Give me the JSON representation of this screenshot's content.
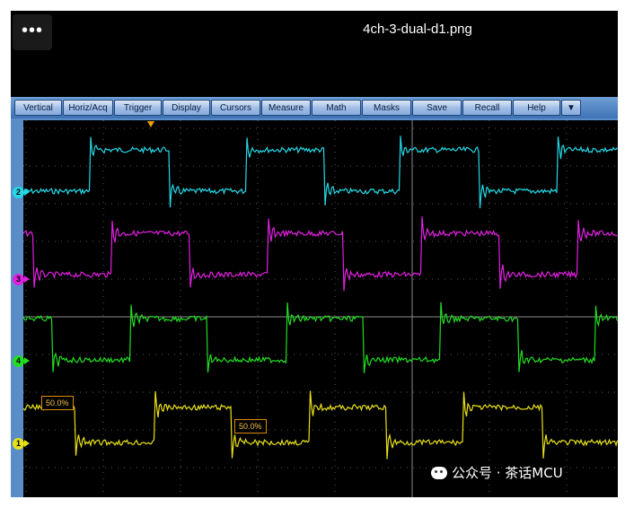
{
  "viewer": {
    "more_label": "•••",
    "file_title": "4ch-3-dual-d1.png"
  },
  "menu": {
    "items": [
      "Vertical",
      "Horiz/Acq",
      "Trigger",
      "Display",
      "Cursors",
      "Measure",
      "Math",
      "Masks",
      "Save",
      "Recall",
      "Help",
      "▼"
    ]
  },
  "channels": [
    {
      "id": "2",
      "color": "#25d8e6"
    },
    {
      "id": "3",
      "color": "#e020e0"
    },
    {
      "id": "4",
      "color": "#22dd22"
    },
    {
      "id": "1",
      "color": "#e8e018"
    }
  ],
  "trigger": {
    "level_labels": [
      "50.0%",
      "50.0%"
    ],
    "marker_color": "#f0a000"
  },
  "watermark": {
    "text": "公众号 · 茶话MCU"
  }
}
